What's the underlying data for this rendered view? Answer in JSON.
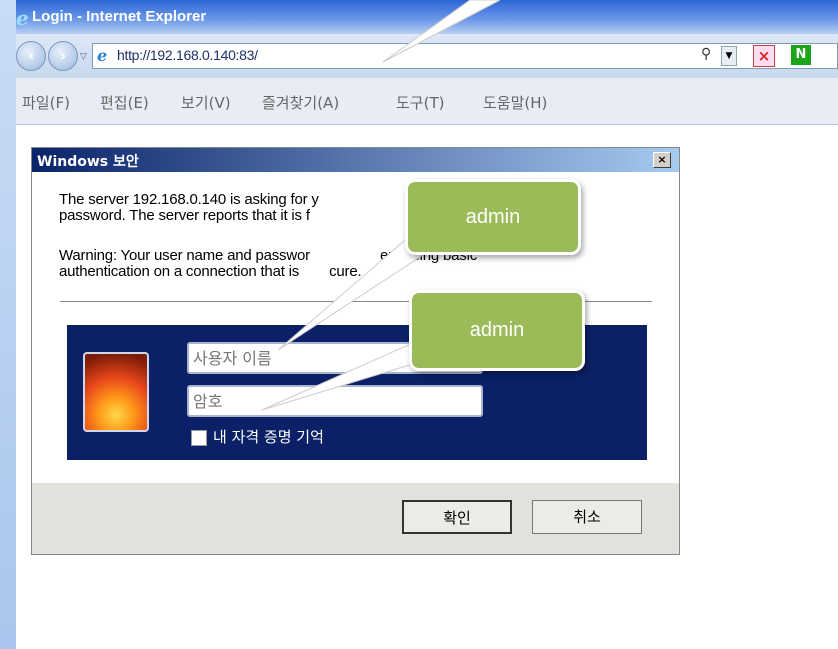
{
  "window": {
    "title": "Login - Internet Explorer"
  },
  "address_bar": {
    "url": "http://192.168.0.140:83/"
  },
  "menu": [
    "파일(F)",
    "편집(E)",
    "보기(V)",
    "즐겨찾기(A)",
    "도구(T)",
    "도움말(H)"
  ],
  "dialog": {
    "title": "Windows 보안",
    "message_line1": "The server 192.168.0.140 is asking for y",
    "message_line2": "password. The server reports that it is f",
    "warning_line1": "Warning: Your user name and passwor",
    "warning_line1_tail": "ent using basic",
    "warning_line2": "authentication on a connection that is",
    "warning_line2_tail": "cure.",
    "username_placeholder": "사용자 이름",
    "password_placeholder": "암호",
    "remember_label": "내 자격 증명 기억",
    "ok_label": "확인",
    "cancel_label": "취소"
  },
  "callouts": {
    "username": "admin",
    "password": "admin"
  },
  "colors": {
    "callout": "#9bbb59",
    "credential_panel": "#0b2066",
    "dialog_title": "#0a246a"
  }
}
